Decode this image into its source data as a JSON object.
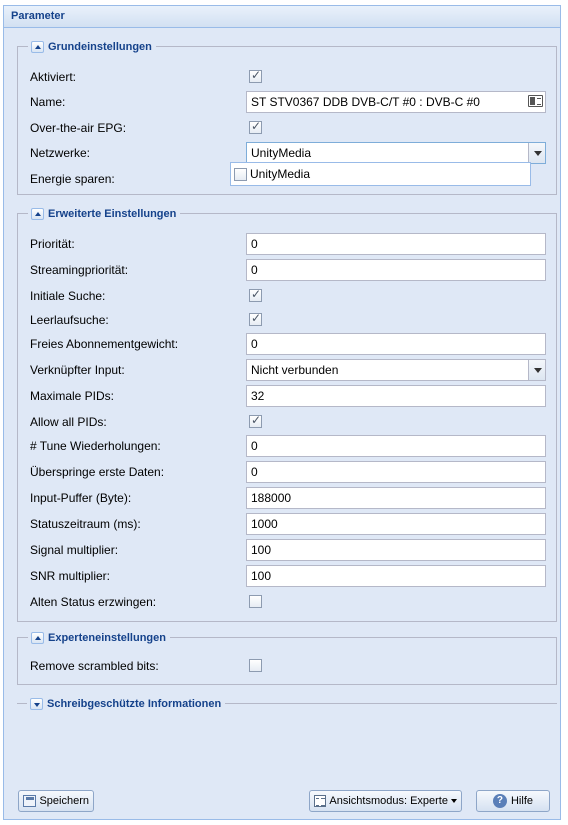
{
  "panel": {
    "title": "Parameter"
  },
  "grundeinstellungen": {
    "legend": "Grundeinstellungen",
    "aktiviert": {
      "label": "Aktiviert:",
      "checked": true
    },
    "name": {
      "label": "Name:",
      "value": "ST STV0367 DDB DVB-C/T #0 : DVB-C #0"
    },
    "epg": {
      "label": "Over-the-air EPG:",
      "checked": true
    },
    "netzwerke": {
      "label": "Netzwerke:",
      "value": "UnityMedia",
      "options": [
        "UnityMedia"
      ]
    },
    "energie": {
      "label": "Energie sparen:"
    }
  },
  "erweitert": {
    "legend": "Erweiterte Einstellungen",
    "prioritaet": {
      "label": "Priorität:",
      "value": "0"
    },
    "streamingprioritaet": {
      "label": "Streamingpriorität:",
      "value": "0"
    },
    "initiale_suche": {
      "label": "Initiale Suche:",
      "checked": true
    },
    "leerlaufsuche": {
      "label": "Leerlaufsuche:",
      "checked": true
    },
    "abo_gewicht": {
      "label": "Freies Abonnementgewicht:",
      "value": "0"
    },
    "verknuepfter_input": {
      "label": "Verknüpfter Input:",
      "value": "Nicht verbunden"
    },
    "max_pids": {
      "label": "Maximale PIDs:",
      "value": "32"
    },
    "allow_all_pids": {
      "label": "Allow all PIDs:",
      "checked": true
    },
    "tune_wiederholungen": {
      "label": "# Tune Wiederholungen:",
      "value": "0"
    },
    "ueberspringe": {
      "label": "Überspringe erste Daten:",
      "value": "0"
    },
    "input_puffer": {
      "label": "Input-Puffer (Byte):",
      "value": "188000"
    },
    "statuszeitraum": {
      "label": "Statuszeitraum (ms):",
      "value": "1000"
    },
    "signal_multiplier": {
      "label": "Signal multiplier:",
      "value": "100"
    },
    "snr_multiplier": {
      "label": "SNR multiplier:",
      "value": "100"
    },
    "alten_status": {
      "label": "Alten Status erzwingen:",
      "checked": false
    }
  },
  "experten": {
    "legend": "Experteneinstellungen",
    "remove_scrambled": {
      "label": "Remove scrambled bits:",
      "checked": false
    }
  },
  "schreibgeschuetzt": {
    "legend": "Schreibgeschützte Informationen"
  },
  "toolbar": {
    "save_label": "Speichern",
    "view_mode_label": "Ansichtsmodus: Experte",
    "help_label": "Hilfe"
  },
  "icons": [
    "chevron-up-icon",
    "chevron-down-icon",
    "id-card-icon",
    "save-icon",
    "view-mode-icon",
    "help-icon"
  ],
  "colors": {
    "panel_bg": "#dfe8f6",
    "header_text": "#15428b",
    "border": "#99bbe8"
  }
}
